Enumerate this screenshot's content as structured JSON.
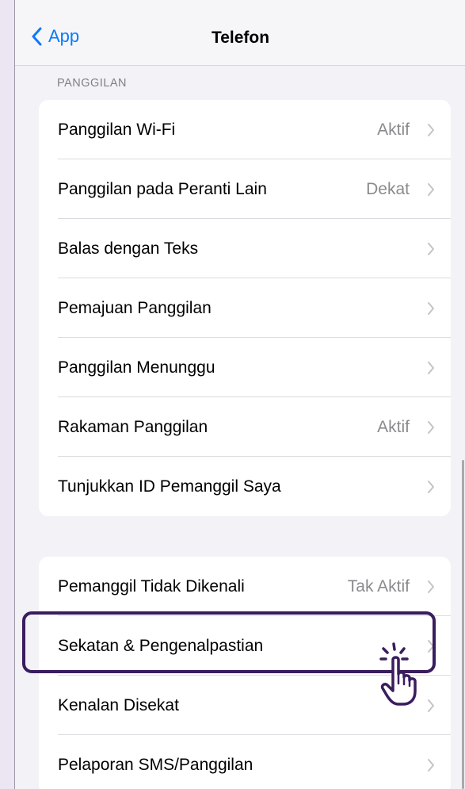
{
  "navbar": {
    "back_label": "App",
    "title": "Telefon"
  },
  "section_header": "PANGGILAN",
  "group1": [
    {
      "label": "Panggilan Wi-Fi",
      "value": "Aktif"
    },
    {
      "label": "Panggilan pada Peranti Lain",
      "value": "Dekat"
    },
    {
      "label": "Balas dengan Teks",
      "value": ""
    },
    {
      "label": "Pemajuan Panggilan",
      "value": ""
    },
    {
      "label": "Panggilan Menunggu",
      "value": ""
    },
    {
      "label": "Rakaman Panggilan",
      "value": "Aktif"
    },
    {
      "label": "Tunjukkan ID Pemanggil Saya",
      "value": ""
    }
  ],
  "group2": [
    {
      "label": "Pemanggil Tidak Dikenali",
      "value": "Tak Aktif"
    },
    {
      "label": "Sekatan & Pengenalpastian",
      "value": ""
    },
    {
      "label": "Kenalan Disekat",
      "value": ""
    },
    {
      "label": "Pelaporan SMS/Panggilan",
      "value": ""
    }
  ],
  "colors": {
    "accent": "#0a7aff",
    "highlight": "#3a1d5e",
    "page_background": "#ece6f2"
  },
  "icons": {
    "back": "chevron-left-icon",
    "row": "chevron-right-icon",
    "pointer": "hand-pointer-icon"
  }
}
